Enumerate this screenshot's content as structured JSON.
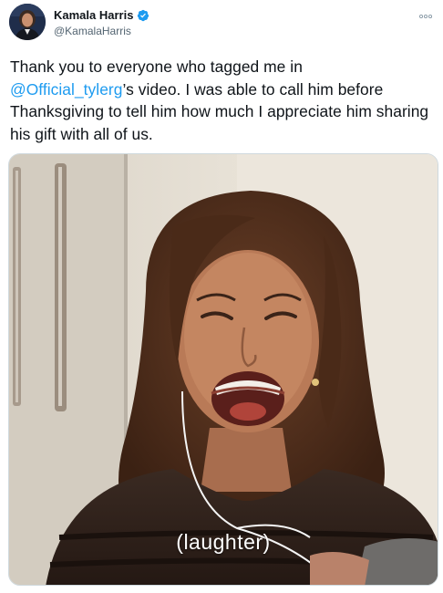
{
  "author": {
    "display_name": "Kamala Harris",
    "handle": "@KamalaHarris",
    "verified": true
  },
  "icons": {
    "verified": "verified-badge-icon",
    "more": "more-options-icon"
  },
  "tweet": {
    "text_before": "Thank you to everyone who tagged me in",
    "mention": "@Official_tylerg",
    "text_after": "’s video. I was able to call him before Thanksgiving to tell him how much I appreciate him sharing his gift with all of us."
  },
  "media": {
    "caption": "(laughter)"
  },
  "colors": {
    "accent": "#1d9bf0",
    "text": "#0f1419",
    "secondary": "#536471"
  }
}
